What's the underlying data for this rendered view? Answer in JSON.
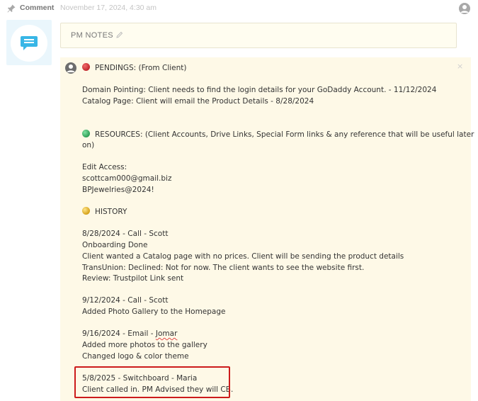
{
  "header": {
    "type_label": "Comment",
    "date": "November 17, 2024, 4:30 am"
  },
  "pm_notes": {
    "label": "PM NOTES"
  },
  "note": {
    "close_glyph": "×",
    "pendings_heading": "PENDINGS: (From Client)",
    "pendings": [
      "Domain Pointing: Client needs to find the login details for your GoDaddy Account. - 11/12/2024",
      "Catalog Page: Client will email the Product Details - 8/28/2024"
    ],
    "resources_heading_line1": "RESOURCES: (Client Accounts, Drive Links, Special Form links & any reference that will be useful later",
    "resources_heading_line2": "on)",
    "edit_access_label": "Edit Access:",
    "edit_access_email": "scottcam000@gmail.biz",
    "edit_access_password": "BPJewelries@2024!",
    "history_heading": "HISTORY",
    "history": [
      {
        "title": "8/28/2024 - Call - Scott",
        "lines": [
          "Onboarding Done",
          "Client wanted a Catalog page with no prices. Client will be sending the product details",
          "TransUnion: Declined: Not for now. The client wants to see the website first.",
          "Review: Trustpilot Link sent"
        ]
      },
      {
        "title": "9/12/2024 - Call - Scott",
        "lines": [
          "Added Photo Gallery to the Homepage"
        ]
      },
      {
        "title_prefix": "9/16/2024 - Email - ",
        "title_name": "Jomar",
        "lines": [
          "Added more photos to the gallery",
          "Changed logo & color theme"
        ]
      },
      {
        "title": "5/8/2025 - Switchboard - Maria",
        "lines": [
          "Client called in. PM Advised they will CB."
        ]
      }
    ]
  },
  "colors": {
    "note_background": "#fef9e7",
    "highlight_border": "#cc1b1b",
    "pending_dot": "#c1272d",
    "resources_dot": "#2e9e55",
    "history_dot": "#d4a017"
  }
}
